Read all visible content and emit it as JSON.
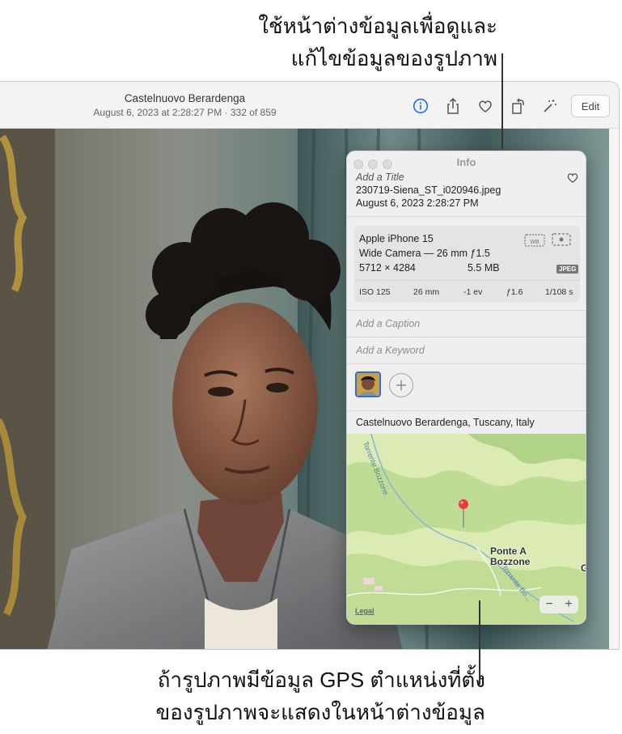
{
  "callouts": {
    "top": [
      "ใช้หน้าต่างข้อมูลเพื่อดูและ",
      "แก้ไขข้อมูลของรูปภาพ"
    ],
    "bottom": [
      "ถ้ารูปภาพมีข้อมูล GPS ตำแหน่งที่ตั้ง",
      "ของรูปภาพจะแสดงในหน้าต่างข้อมูล"
    ]
  },
  "toolbar": {
    "title": "Castelnuovo Berardenga",
    "subtitle": "August 6, 2023 at 2:28:27 PM  ·  332 of 859",
    "edit_label": "Edit",
    "icons": [
      "info-icon",
      "share-icon",
      "heart-icon",
      "rotate-icon",
      "magic-wand-icon"
    ],
    "accent_color": "#1a6ff5"
  },
  "info_panel": {
    "title": "Info",
    "add_title_placeholder": "Add a Title",
    "filename": "230719-Siena_ST_i020946.jpeg",
    "datetime": "August 6, 2023   2:28:27 PM",
    "camera": {
      "model": "Apple iPhone 15",
      "lens": "Wide Camera — 26 mm ƒ1.5",
      "dimensions": "5712 × 4284",
      "filesize": "5.5 MB",
      "format": "JPEG",
      "exif": [
        "ISO 125",
        "26 mm",
        "-1 ev",
        "ƒ1.6",
        "1/108 s"
      ]
    },
    "caption_placeholder": "Add a Caption",
    "keyword_placeholder": "Add a Keyword",
    "location": "Castelnuovo Berardenga, Tuscany, Italy",
    "map": {
      "place_label_1": "Ponte A",
      "place_label_2": "Bozzone",
      "river_label_1": "Torrente Bozzone",
      "river_label_2": "Torrente Bo...",
      "edge_label": "G",
      "legal": "Legal",
      "zoom_out": "−",
      "zoom_in": "+"
    }
  }
}
